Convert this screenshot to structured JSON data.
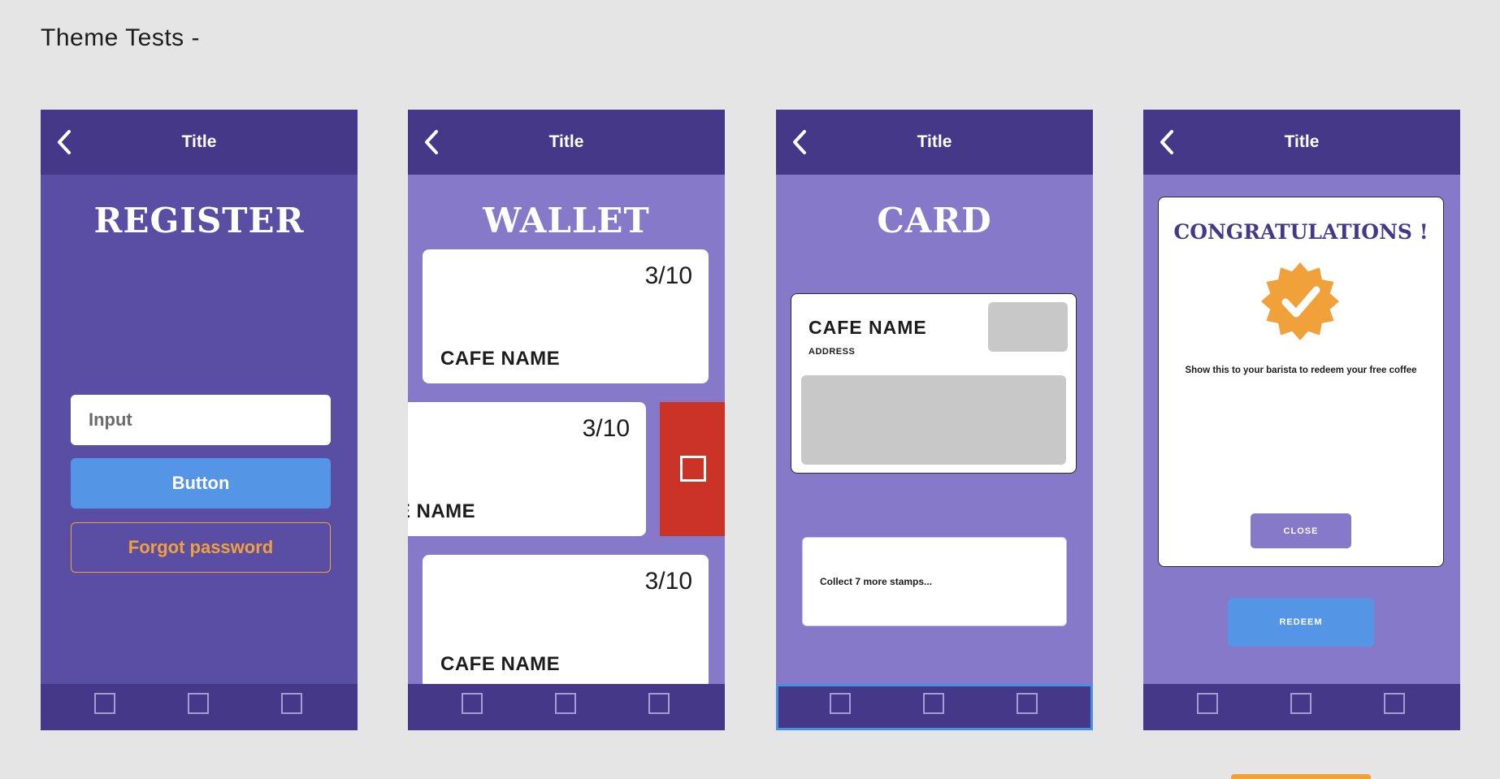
{
  "page": {
    "title": "Theme Tests -"
  },
  "colors": {
    "header": "#463888",
    "register_bg": "#5a4da4",
    "light_bg": "#8679c9",
    "primary_button": "#5595e5",
    "accent_orange": "#f0a13a",
    "delete_red": "#cc3327"
  },
  "screens": [
    {
      "header_title": "Title",
      "heading": "REGISTER",
      "input_placeholder": "Input",
      "button_label": "Button",
      "forgot_label": "Forgot password"
    },
    {
      "header_title": "Title",
      "heading": "WALLET",
      "cards": [
        {
          "count": "3/10",
          "cafe_name": "CAFE NAME"
        },
        {
          "count": "3/10",
          "cafe_name": "CAFE NAME"
        },
        {
          "count": "3/10",
          "cafe_name": "CAFE NAME"
        }
      ]
    },
    {
      "header_title": "Title",
      "heading": "CARD",
      "cafe_name": "CAFE NAME",
      "address": "ADDRESS",
      "stamps_text": "Collect 7 more stamps..."
    },
    {
      "header_title": "Title",
      "heading": "CONGRATULATIONS !",
      "message": "Show this to your barista to redeem your free coffee",
      "close_label": "CLOSE",
      "redeem_label": "REDEEM"
    }
  ],
  "icons": {
    "back": "back-icon",
    "nav": [
      "nav-icon-1",
      "nav-icon-2",
      "nav-icon-3"
    ],
    "badge": "verified-badge-icon"
  }
}
